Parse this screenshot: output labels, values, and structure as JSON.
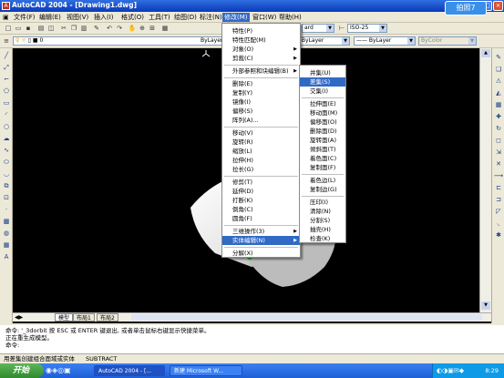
{
  "window": {
    "title": "AutoCAD 2004 - [Drawing1.dwg]",
    "app_icon": "autocad-app-icon",
    "min_label": "_",
    "max_label": "□",
    "close_label": "×"
  },
  "menubar": {
    "items": [
      "文件(F)",
      "编辑(E)",
      "视图(V)",
      "插入(I)",
      "格式(O)",
      "工具(T)",
      "绘图(D)",
      "标注(N)",
      "修改(M)",
      "窗口(W)",
      "帮助(H)"
    ],
    "active": "修改(M)"
  },
  "overlay_badge": "拍照7",
  "toolbar": {
    "style_combo": "ard",
    "dimstyle_combo": "ISO-25"
  },
  "props": {
    "layer_value": "0",
    "color_value": "ByLayer",
    "linetype_value": "ByLayer",
    "lineweight_value": "ByLayer",
    "plotstyle_value": "ByColor"
  },
  "modify_menu": {
    "items": [
      {
        "label": "特性(P)"
      },
      {
        "label": "特性匹配(M)"
      },
      {
        "label": "对象(O)",
        "submenu": true
      },
      {
        "label": "剪裁(C)",
        "submenu": true
      },
      {
        "label": "外部参照和块编辑(B)",
        "submenu": true
      },
      {
        "label": "删除(E)"
      },
      {
        "label": "复制(Y)"
      },
      {
        "label": "镜像(I)"
      },
      {
        "label": "偏移(S)"
      },
      {
        "label": "阵列(A)..."
      },
      {
        "label": "移动(V)"
      },
      {
        "label": "旋转(R)"
      },
      {
        "label": "缩放(L)"
      },
      {
        "label": "拉伸(H)"
      },
      {
        "label": "拉长(G)"
      },
      {
        "label": "修剪(T)"
      },
      {
        "label": "延伸(D)"
      },
      {
        "label": "打断(K)"
      },
      {
        "label": "倒角(C)"
      },
      {
        "label": "圆角(F)"
      },
      {
        "label": "三维操作(3)",
        "submenu": true
      },
      {
        "label": "实体编辑(N)",
        "submenu": true,
        "highlighted": true
      },
      {
        "label": "分解(X)"
      }
    ],
    "submenu_arrow": "▶"
  },
  "solid_edit_menu": {
    "items": [
      {
        "label": "并集(U)"
      },
      {
        "label": "差集(S)",
        "highlighted": true
      },
      {
        "label": "交集(I)"
      },
      {
        "label": "拉伸面(E)"
      },
      {
        "label": "移动面(M)"
      },
      {
        "label": "偏移面(O)"
      },
      {
        "label": "删除面(D)"
      },
      {
        "label": "旋转面(A)"
      },
      {
        "label": "倾斜面(T)"
      },
      {
        "label": "着色面(C)"
      },
      {
        "label": "复制面(F)"
      },
      {
        "label": "着色边(L)"
      },
      {
        "label": "复制边(G)"
      },
      {
        "label": "压印(I)"
      },
      {
        "label": "清除(N)"
      },
      {
        "label": "分割(S)"
      },
      {
        "label": "抽壳(H)"
      },
      {
        "label": "检查(K)"
      }
    ]
  },
  "tabs": [
    "模型",
    "布局1",
    "布局2"
  ],
  "command": {
    "lines": [
      "命令: '_3dorbit 按 ESC 或 ENTER 键退出, 或者单击鼠标右键显示快捷菜单。",
      "正在重生成模型。",
      "命令:"
    ]
  },
  "status": {
    "hint": "用差集创建组合面域或实体",
    "command": "SUBTRACT"
  },
  "taskbar": {
    "start_label": "开始",
    "tasks": [
      "AutoCAD 2004 - [...",
      "新建 Microsoft W..."
    ],
    "clock": "8:29"
  }
}
